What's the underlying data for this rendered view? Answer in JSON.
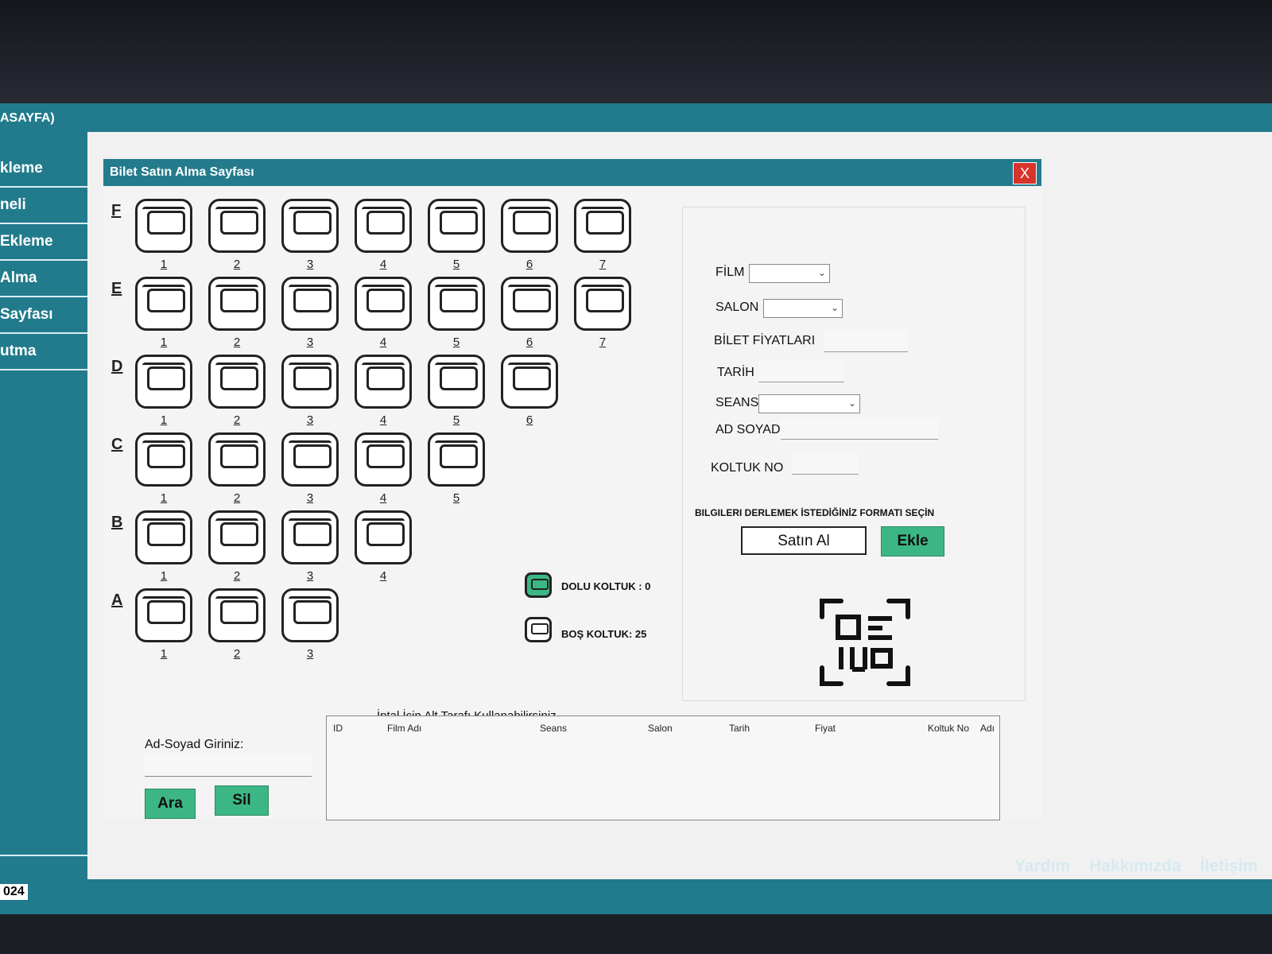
{
  "app": {
    "title": "ASAYFA)",
    "year_fragment": "024",
    "footer_links": [
      "Yardım",
      "Hakkımızda",
      "İletişim"
    ]
  },
  "sidebar": {
    "items": [
      {
        "label": "kleme"
      },
      {
        "label": "neli"
      },
      {
        "label": "Ekleme"
      },
      {
        "label": "Alma"
      },
      {
        "label": "Sayfası"
      },
      {
        "label": "utma"
      }
    ]
  },
  "window": {
    "title": "Bilet Satın Alma Sayfası",
    "close_label": "X"
  },
  "seat_rows": [
    {
      "letter": "F",
      "seats": [
        "1",
        "2",
        "3",
        "4",
        "5",
        "6",
        "7"
      ]
    },
    {
      "letter": "E",
      "seats": [
        "1",
        "2",
        "3",
        "4",
        "5",
        "6",
        "7"
      ]
    },
    {
      "letter": "D",
      "seats": [
        "1",
        "2",
        "3",
        "4",
        "5",
        "6"
      ]
    },
    {
      "letter": "C",
      "seats": [
        "1",
        "2",
        "3",
        "4",
        "5"
      ]
    },
    {
      "letter": "B",
      "seats": [
        "1",
        "2",
        "3",
        "4"
      ]
    },
    {
      "letter": "A",
      "seats": [
        "1",
        "2",
        "3"
      ]
    }
  ],
  "legend": {
    "occupied": "DOLU KOLTUK : 0",
    "empty": "BOŞ KOLTUK: 25",
    "occupied_color": "#3db686"
  },
  "form": {
    "film_label": "FİLM",
    "salon_label": "SALON",
    "price_label": "BİLET FİYATLARI",
    "date_label": "TARİH",
    "session_label": "SEANS",
    "name_label": "AD SOYAD",
    "seat_label": "KOLTUK NO",
    "format_prompt": "BILGILERI DERLEMEK İSTEDİĞİNİZ FORMATI SEÇİN",
    "buy_button": "Satın Al",
    "add_button": "Ekle"
  },
  "cancel": {
    "hint": "İptal İçin Alt Tarafı Kullanabilirsiniz",
    "search_label": "Ad-Soyad Giriniz:",
    "search_button": "Ara",
    "delete_button": "Sil",
    "columns": [
      "ID",
      "Film Adı",
      "Seans",
      "Salon",
      "Tarih",
      "Fiyat",
      "Koltuk No",
      "Adı"
    ]
  },
  "colors": {
    "teal": "#237b8d",
    "green_button": "#3db686",
    "close_red": "#d9342b"
  }
}
